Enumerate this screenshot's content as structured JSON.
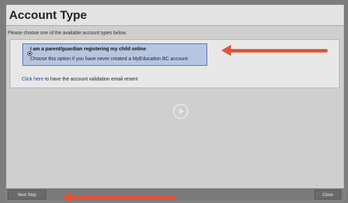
{
  "dialog": {
    "title": "Account Type",
    "instructions": "Please choose one of the available account types below."
  },
  "option": {
    "title": "I am a parent/guardian registering my child online",
    "description": "Choose this option if you have never created a MyEducation BC account",
    "selected": true
  },
  "resend": {
    "link_text": "Click here",
    "rest_text": " to have the account validation email resent"
  },
  "footer": {
    "next_label": "Next Step",
    "close_label": "Close"
  },
  "colors": {
    "arrow": "#e0553a",
    "selected_option": "#b6c6e2",
    "link": "#1b3fa8"
  },
  "icons": {
    "play": "play-circle-icon",
    "radio": "radio-selected-icon"
  }
}
